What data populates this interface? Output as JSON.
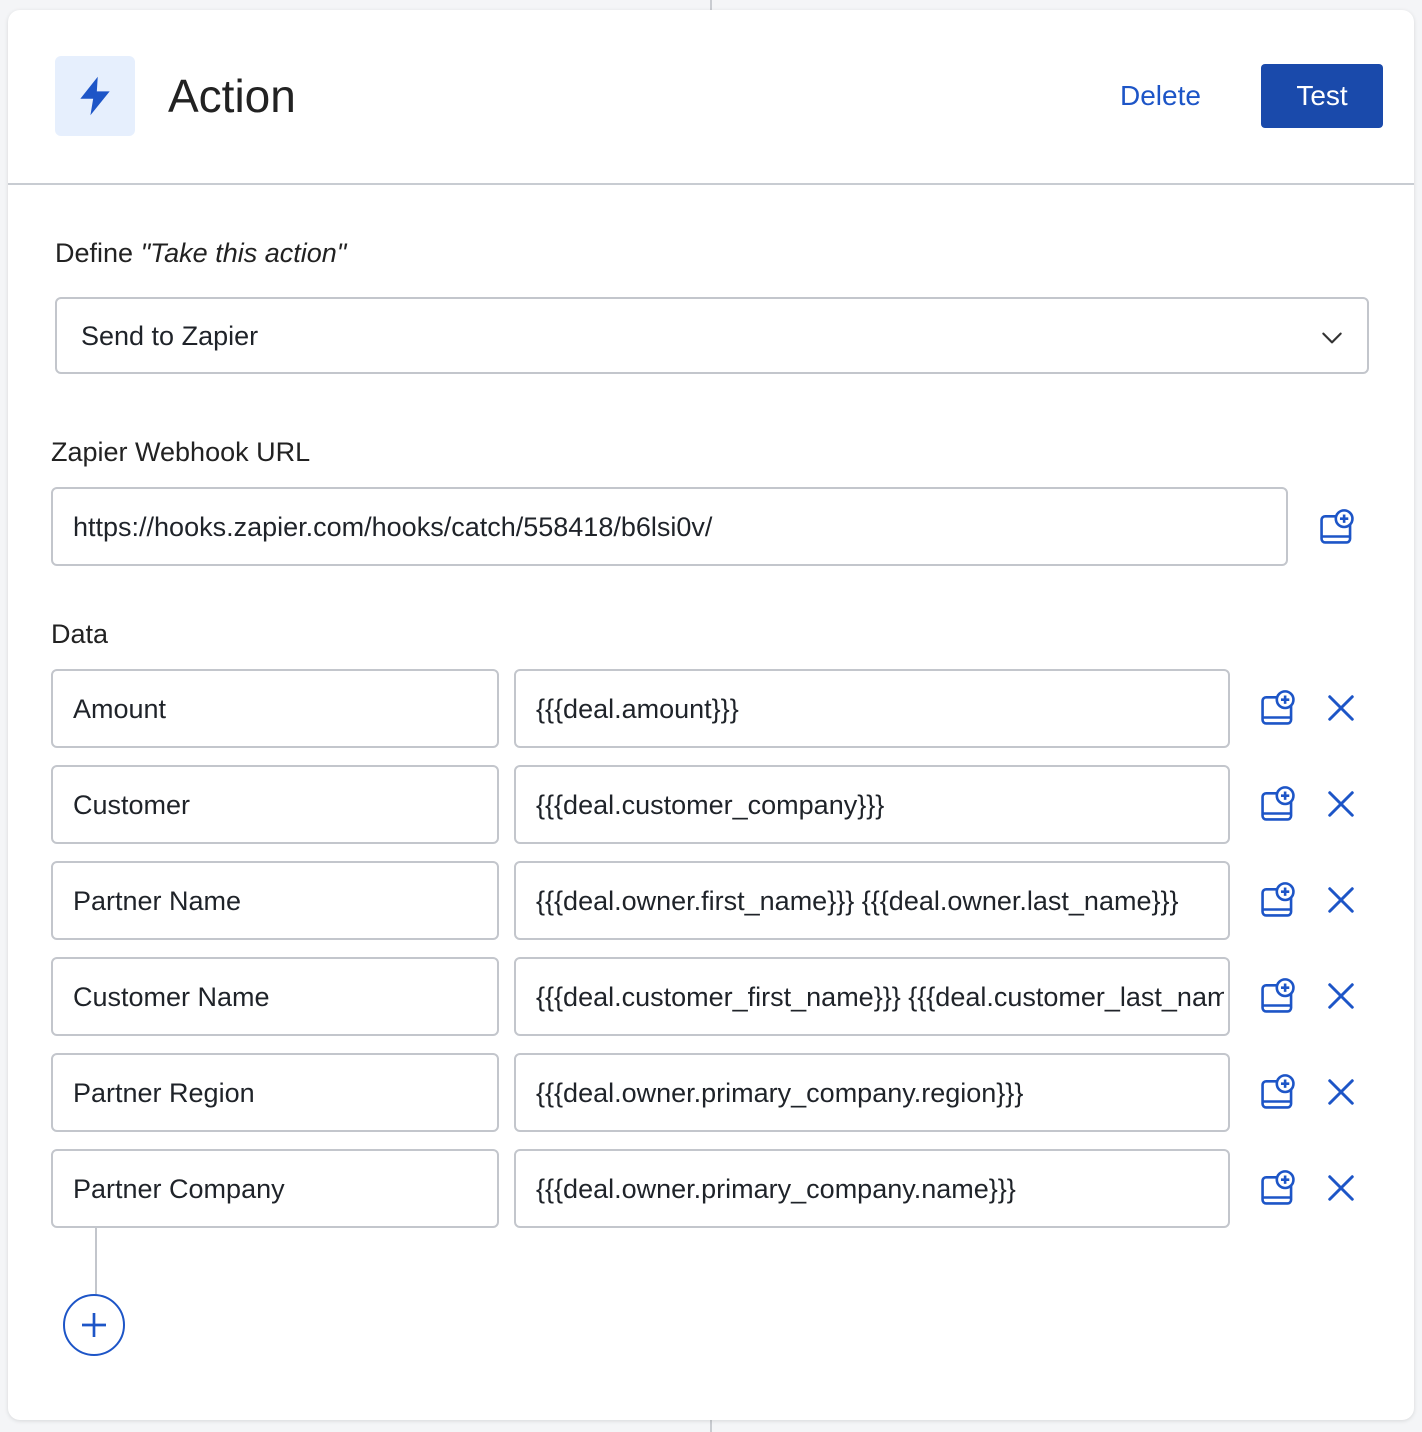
{
  "header": {
    "title": "Action",
    "icon": "lightning-bolt-icon",
    "delete_label": "Delete",
    "test_label": "Test"
  },
  "define": {
    "label_prefix": "Define ",
    "label_italic": "\"Take this action\"",
    "selected_value": "Send to Zapier"
  },
  "webhook": {
    "label": "Zapier Webhook URL",
    "value": "https://hooks.zapier.com/hooks/catch/558418/b6lsi0v/"
  },
  "data": {
    "label": "Data",
    "rows": [
      {
        "key": "Amount",
        "value": "{{{deal.amount}}}"
      },
      {
        "key": "Customer",
        "value": "{{{deal.customer_company}}}"
      },
      {
        "key": "Partner Name",
        "value": "{{{deal.owner.first_name}}} {{{deal.owner.last_name}}}"
      },
      {
        "key": "Customer Name",
        "value": "{{{deal.customer_first_name}}} {{{deal.customer_last_name}}}"
      },
      {
        "key": "Partner Region",
        "value": "{{{deal.owner.primary_company.region}}}"
      },
      {
        "key": "Partner Company",
        "value": "{{{deal.owner.primary_company.name}}}"
      }
    ]
  },
  "colors": {
    "accent": "#1d55c7",
    "button_primary": "#1a4aab",
    "icon_bg": "#e6effd",
    "border": "#c3c6cc"
  }
}
